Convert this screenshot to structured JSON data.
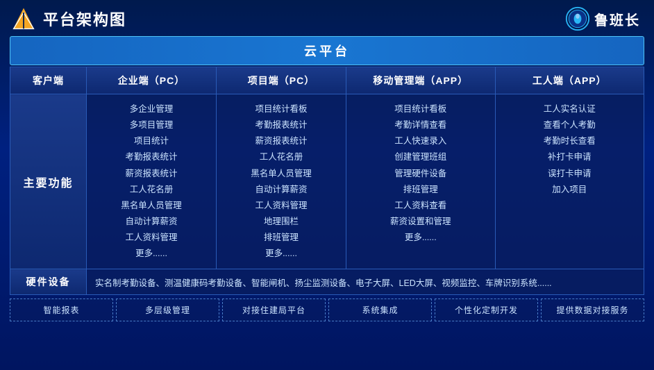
{
  "header": {
    "title": "平台架构图",
    "brand": "鲁班长"
  },
  "cloud_bar": "云平台",
  "columns": {
    "client": "客户端",
    "enterprise": "企业端（PC）",
    "project_pc": "项目端（PC）",
    "mobile_app": "移动管理端（APP）",
    "worker_app": "工人端（APP）"
  },
  "main_func_label": "主要功能",
  "enterprise_funcs": [
    "多企业管理",
    "多项目管理",
    "项目统计",
    "考勤报表统计",
    "薪资报表统计",
    "工人花名册",
    "黑名单人员管理",
    "自动计算薪资",
    "工人资料管理",
    "更多......"
  ],
  "project_funcs": [
    "项目统计看板",
    "考勤报表统计",
    "薪资报表统计",
    "工人花名册",
    "黑名单人员管理",
    "自动计算薪资",
    "工人资料管理",
    "地理围栏",
    "排班管理",
    "更多......"
  ],
  "mobile_funcs": [
    "项目统计看板",
    "考勤详情查看",
    "工人快速录入",
    "创建管理班组",
    "管理硬件设备",
    "排班管理",
    "工人资料查看",
    "薪资设置和管理",
    "更多......"
  ],
  "worker_funcs": [
    "工人实名认证",
    "查看个人考勤",
    "考勤时长查看",
    "补打卡申请",
    "误打卡申请",
    "加入项目"
  ],
  "hardware": {
    "label": "硬件设备",
    "content": "实名制考勤设备、测温健康码考勤设备、智能闸机、扬尘监测设备、电子大屏、LED大屏、视频监控、车牌识别系统......"
  },
  "services": [
    "智能报表",
    "多层级管理",
    "对接住建局平台",
    "系统集成",
    "个性化定制开发",
    "提供数据对接服务"
  ]
}
